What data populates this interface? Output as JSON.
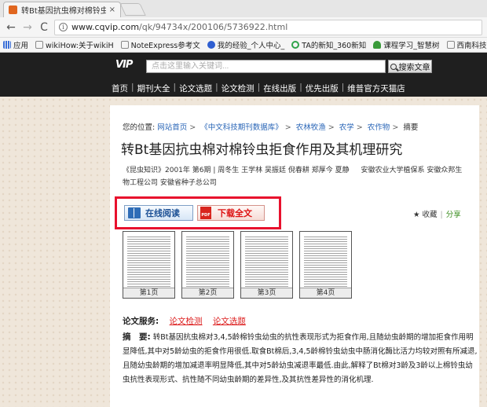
{
  "browser": {
    "tab_title": "转Bt基因抗虫棉对棉铃虫",
    "tab_close": "×",
    "url_host": "www.cqvip.com",
    "url_path": "/qk/94734x/200106/5736922.html",
    "bookmarks": [
      "应用",
      "wikiHow:关于wikiH",
      "NoteExpress参考文",
      "我的经验_个人中心_",
      "TA的新知_360新知",
      "课程学习_智慧树",
      "西南科技"
    ]
  },
  "site": {
    "logo": "VIP",
    "search_placeholder": "点击这里输入关键词...",
    "search_button": "搜索文章",
    "nav": [
      "首页",
      "期刊大全",
      "论文选题",
      "论文检测",
      "在线出版",
      "优先出版",
      "维普官方天猫店"
    ]
  },
  "article": {
    "breadcrumb_prefix": "您的位置:",
    "breadcrumb": [
      "网站首页",
      "《中文科技期刊数据库》",
      "农林牧渔",
      "农学",
      "农作物"
    ],
    "breadcrumb_current": "摘要",
    "title": "转Bt基因抗虫棉对棉铃虫拒食作用及其机理研究",
    "journal": "《昆虫知识》2001年 第6期",
    "authors": "周冬生 王学林 吴振廷 倪春耕 郑厚今 夏静",
    "affiliation_1": "安徽农业大学植保系 安徽众邦生",
    "affiliation_2": "物工程公司 安徽省种子总公司",
    "read_button": "在线阅读",
    "download_button": "下载全文",
    "pdf_label": "PDF",
    "favorite": "★ 收藏",
    "share": "分享",
    "pages": [
      "第1页",
      "第2页",
      "第3页",
      "第4页"
    ],
    "service_label": "论文服务:",
    "service_links": [
      "论文检测",
      "论文选题"
    ],
    "abstract_label": "摘　要:",
    "abstract_text": "转Bt基因抗虫棉对3,4,5龄棉铃虫幼虫的抗性表现形式为拒食作用,且随幼虫龄期的增加拒食作用明显降低,其中对5龄幼虫的拒食作用很低.取食Bt棉后,3,4,5龄棉铃虫幼虫中肠消化酶比活力均较对照有所减退,且随幼虫龄期的增加减退率明显降低,其中对5龄幼虫减退率最低.由此,解释了Bt棉对3龄及3龄以上棉铃虫幼虫抗性表现形式、抗性随不同幼虫龄期的差异性,及其抗性差异性的消化机理."
  }
}
